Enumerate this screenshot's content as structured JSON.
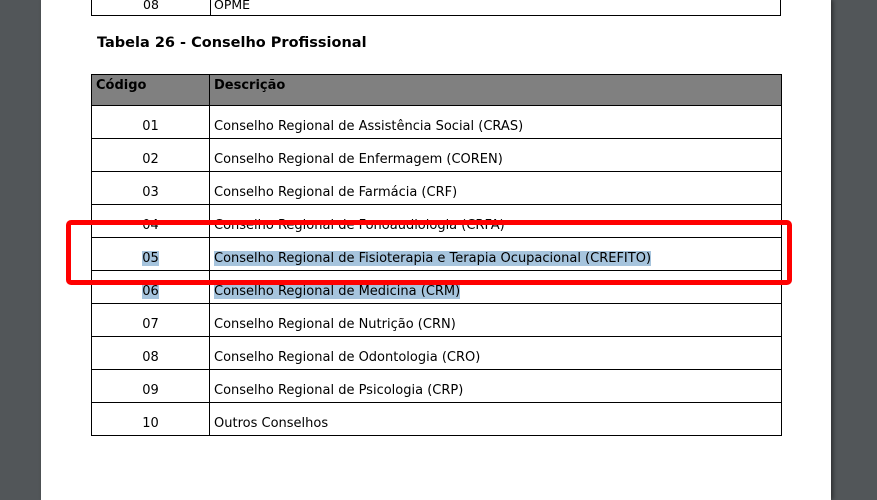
{
  "previous_table": {
    "code": "08",
    "description": "OPME"
  },
  "title": "Tabela 26 - Conselho Profissional",
  "table": {
    "headers": [
      "Código",
      "Descrição"
    ],
    "rows": [
      {
        "code": "01",
        "description": "Conselho Regional de Assistência Social (CRAS)"
      },
      {
        "code": "02",
        "description": "Conselho Regional de Enfermagem (COREN)"
      },
      {
        "code": "03",
        "description": "Conselho Regional de Farmácia (CRF)"
      },
      {
        "code": "04",
        "description": "Conselho Regional de Fonoaudiologia (CRFA)"
      },
      {
        "code": "05",
        "description": "Conselho Regional de Fisioterapia e Terapia Ocupacional (CREFITO)"
      },
      {
        "code": "06",
        "description": "Conselho Regional de Medicina (CRM)"
      },
      {
        "code": "07",
        "description": "Conselho Regional de Nutrição (CRN)"
      },
      {
        "code": "08",
        "description": "Conselho Regional de Odontologia (CRO)"
      },
      {
        "code": "09",
        "description": "Conselho Regional de Psicologia (CRP)"
      },
      {
        "code": "10",
        "description": "Outros Conselhos"
      }
    ]
  },
  "colors": {
    "viewer_background": "#525659",
    "header_fill": "#808080",
    "selection_highlight": "#a6c4dd",
    "annotation_box": "#ff0000"
  }
}
